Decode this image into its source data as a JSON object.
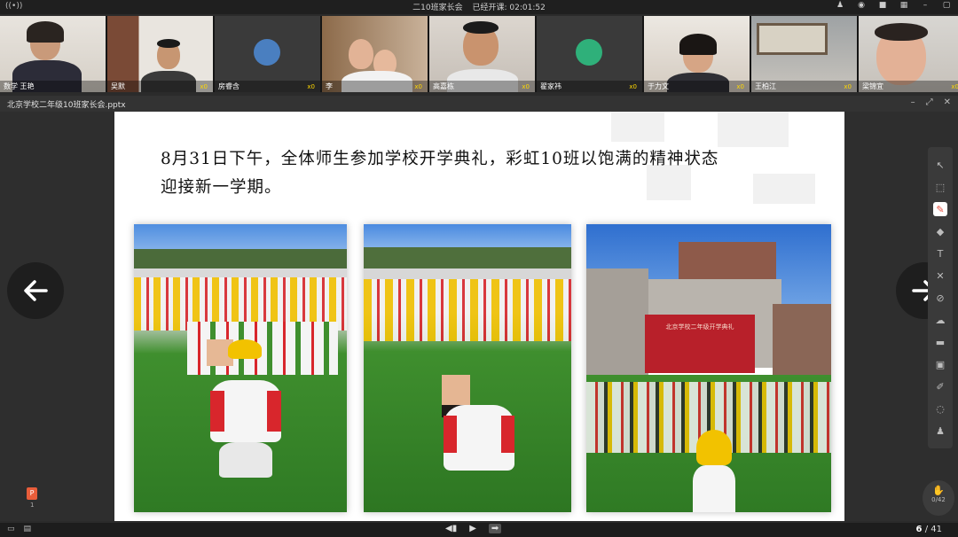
{
  "topbar": {
    "meeting_title": "二10班家长会",
    "timer_text": "已经开课: 02:01:52"
  },
  "participants": [
    {
      "name": "数学 王艳",
      "mic": ""
    },
    {
      "name": "吴默",
      "mic": "x0"
    },
    {
      "name": "房睿含",
      "mic": "x0"
    },
    {
      "name": "李",
      "mic": "x0"
    },
    {
      "name": "高嘉栋",
      "mic": "x0"
    },
    {
      "name": "翟家祎",
      "mic": "x0"
    },
    {
      "name": "于力文",
      "mic": "x0"
    },
    {
      "name": "王柏江",
      "mic": "x0"
    },
    {
      "name": "梁锦宜",
      "mic": "x0"
    }
  ],
  "document": {
    "filename": "北京学校二年级10班家长会.pptx"
  },
  "slide": {
    "caption_line1": "8月31日下午，全体师生参加学校开学典礼，彩虹10班以饱满的精神状态",
    "caption_line2": "迎接新一学期。",
    "banner_text": "北京学校二年级开学典礼"
  },
  "toolbar_icons": [
    "pointer-icon",
    "select-icon",
    "pen-icon",
    "eraser-icon",
    "text-icon",
    "shape-icon",
    "clear-icon",
    "cloud-icon",
    "toolbox-icon",
    "save-icon",
    "edit-icon",
    "chat-icon",
    "users-icon"
  ],
  "ppt_badge": {
    "label": "P",
    "count": "1"
  },
  "counter": {
    "value": "0/42"
  },
  "pagination": {
    "current": "6",
    "total": "41",
    "separator": "/"
  },
  "colors": {
    "accent": "#f2c200",
    "uniform_red": "#d8262c",
    "grass": "#3f8f2e",
    "sky": "#3d7fd6"
  }
}
